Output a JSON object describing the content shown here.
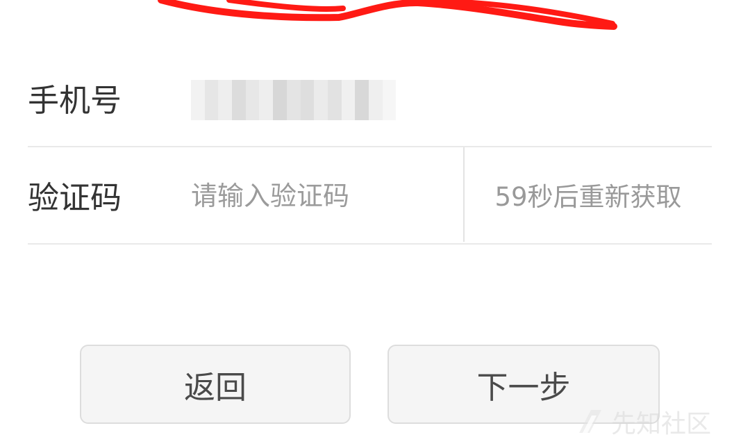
{
  "form": {
    "phone": {
      "label": "手机号"
    },
    "verification": {
      "label": "验证码",
      "placeholder": "请输入验证码",
      "countdown_label": "59秒后重新获取"
    }
  },
  "actions": {
    "back_label": "返回",
    "next_label": "下一步"
  },
  "watermark": {
    "text": "先知社区"
  },
  "colors": {
    "redaction_stroke": "#ff1a14",
    "divider": "#e9e9e9",
    "button_background": "#f5f5f5",
    "button_border": "#dddddd",
    "text_primary": "#333333",
    "text_muted": "#999999"
  }
}
